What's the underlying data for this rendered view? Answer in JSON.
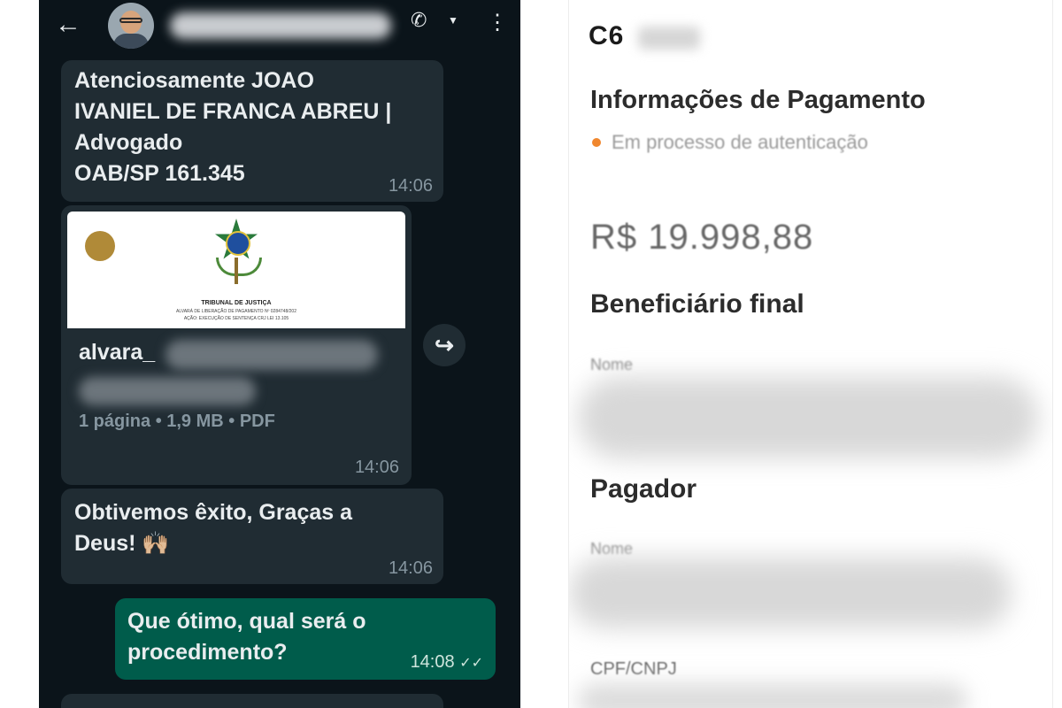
{
  "chat": {
    "messages": [
      {
        "text": "Atenciosamente JOAO\nIVANIEL DE FRANCA ABREU |\nAdvogado\nOAB/SP 161.345",
        "time": "14:06",
        "direction": "incoming"
      },
      {
        "type": "document",
        "name_prefix": "alvara_",
        "meta": "1 página • 1,9 MB • PDF",
        "time": "14:06",
        "thumbnail": {
          "title": "TRIBUNAL DE JUSTIÇA",
          "line1": "ALVARÁ DE LIBERAÇÃO DE PAGAMENTO Nº 0284748/202",
          "line2": "AÇÃO: EXECUÇÃO DE SENTENÇA CRJ LEI 13.105"
        },
        "direction": "incoming"
      },
      {
        "text": "Obtivemos êxito, Graças a\nDeus! 🙌🏼",
        "time": "14:06",
        "direction": "incoming"
      },
      {
        "text": "Que ótimo, qual será o\nprocedimento?",
        "time": "14:08",
        "ticks": "✓✓",
        "direction": "outgoing"
      }
    ],
    "header_icons": [
      "back-arrow-icon",
      "avatar",
      "phone-icon",
      "dropdown-icon",
      "more-vert-icon"
    ],
    "forward_icon": "forward-icon"
  },
  "bank": {
    "logo": "C6",
    "payment_title": "Informações de Pagamento",
    "status": "Em processo de autenticação",
    "amount": "R$ 19.998,88",
    "beneficiary_title": "Beneficiário final",
    "beneficiary_label": "Nome",
    "payer_title": "Pagador",
    "payer_label": "Nome",
    "cpf_label": "CPF/CNPJ",
    "status_color": "#f0872e"
  }
}
